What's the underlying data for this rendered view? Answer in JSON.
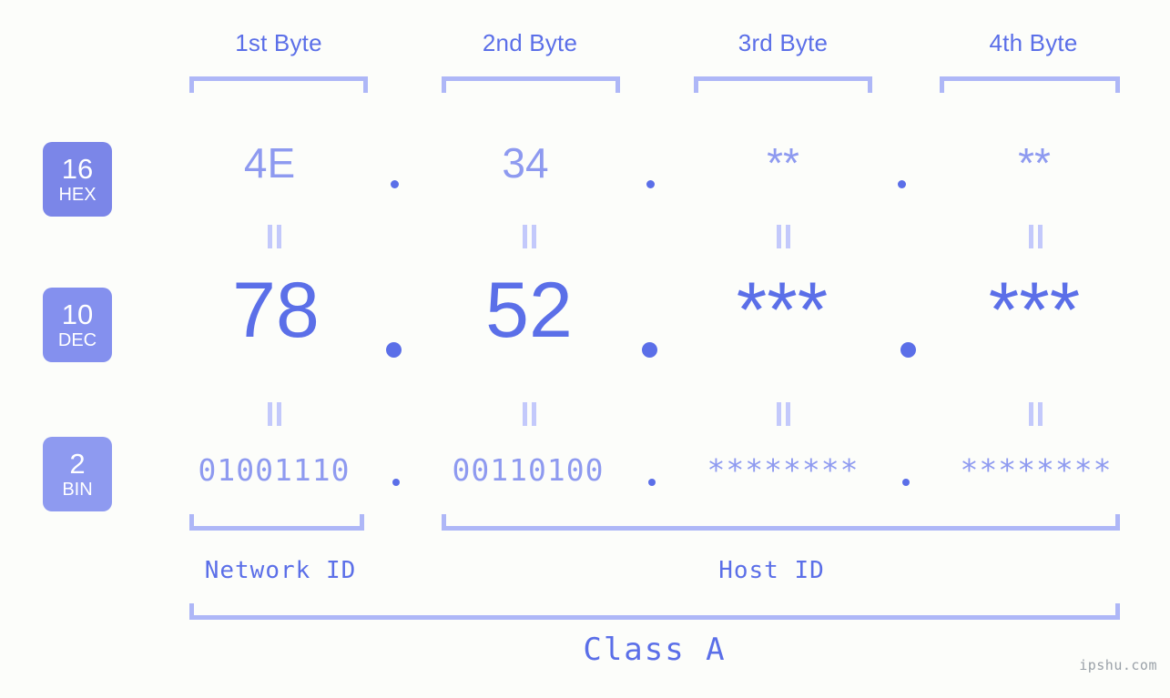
{
  "colors": {
    "background": "#fcfdfa",
    "accent_strong": "#5b6fe8",
    "accent_mid": "#8e9af0",
    "accent_light": "#aeb7f7",
    "badge_hex": "#7b86e8",
    "badge_dec": "#8490ee",
    "badge_bin": "#8e9af0",
    "watermark": "#9aa1a8"
  },
  "byte_headers": [
    {
      "label": "1st Byte"
    },
    {
      "label": "2nd Byte"
    },
    {
      "label": "3rd Byte"
    },
    {
      "label": "4th Byte"
    }
  ],
  "bases": [
    {
      "num": "16",
      "label": "HEX"
    },
    {
      "num": "10",
      "label": "DEC"
    },
    {
      "num": "2",
      "label": "BIN"
    }
  ],
  "rows": {
    "hex": {
      "base_num": "16",
      "base_label": "HEX",
      "values": [
        "4E",
        "34",
        "**",
        "**"
      ],
      "separator": "."
    },
    "dec": {
      "base_num": "10",
      "base_label": "DEC",
      "values": [
        "78",
        "52",
        "***",
        "***"
      ],
      "separator": "."
    },
    "bin": {
      "base_num": "2",
      "base_label": "BIN",
      "values": [
        "01001110",
        "00110100",
        "********",
        "********"
      ],
      "separator": "."
    }
  },
  "equals_symbol": "=",
  "segments": {
    "network_id": "Network ID",
    "host_id": "Host ID",
    "class": "Class A"
  },
  "watermark": "ipshu.com"
}
